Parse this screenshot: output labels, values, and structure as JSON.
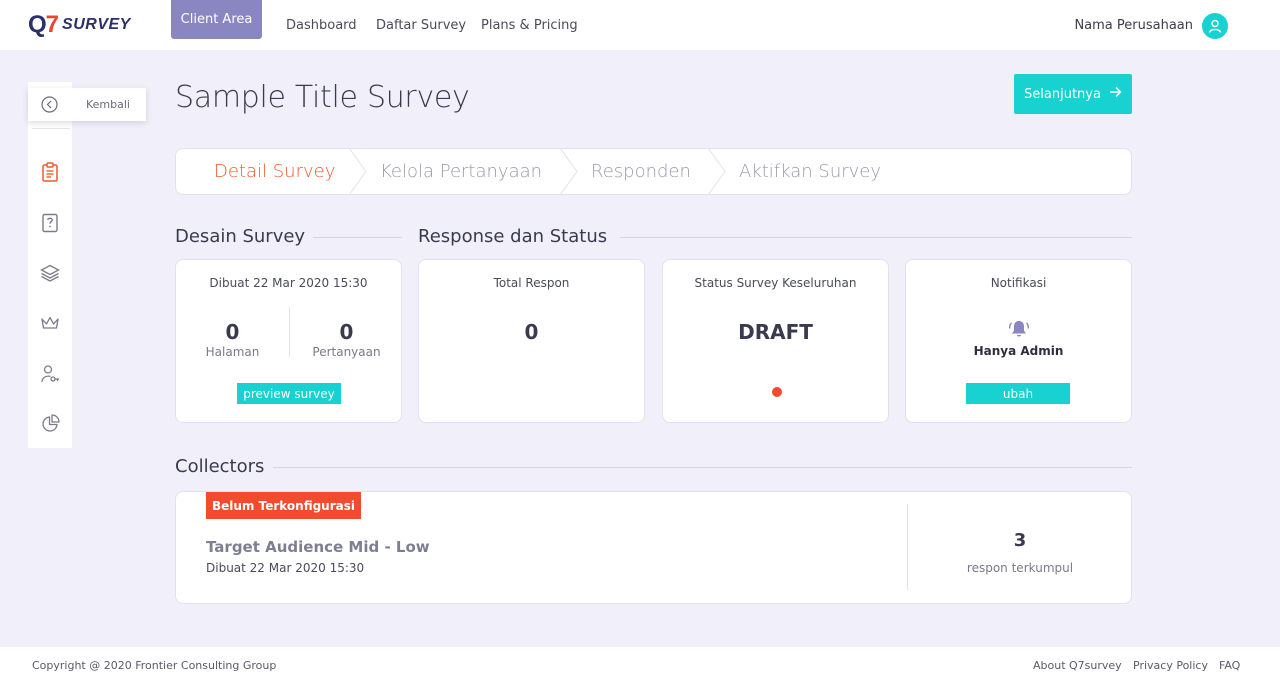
{
  "brand": {
    "logo_mark": "Q7",
    "logo_text": "SURVEY"
  },
  "nav": {
    "active": "Client Area",
    "links": [
      "Dashboard",
      "Daftar Survey",
      "Plans & Pricing"
    ],
    "company": "Nama Perusahaan"
  },
  "sidebar": {
    "back_label": "Kembali",
    "icons": [
      "clipboard-icon",
      "question-icon",
      "layers-icon",
      "crown-icon",
      "user-key-icon",
      "pie-chart-icon"
    ]
  },
  "page": {
    "title": "Sample Title Survey",
    "next_label": "Selanjutnya"
  },
  "steps": [
    "Detail Survey",
    "Kelola Pertanyaan",
    "Responden",
    "Aktifkan Survey"
  ],
  "desain": {
    "heading": "Desain Survey",
    "created": "Dibuat 22 Mar 2020  15:30",
    "pages_count": "0",
    "pages_label": "Halaman",
    "questions_count": "0",
    "questions_label": "Pertanyaan",
    "preview_label": "preview survey"
  },
  "response": {
    "heading": "Response dan Status",
    "total_label": "Total Respon",
    "total_value": "0",
    "status_label": "Status Survey Keseluruhan",
    "status_value": "DRAFT",
    "status_color": "#f24b2e",
    "notif_label": "Notifikasi",
    "notif_value": "Hanya Admin",
    "notif_button": "ubah"
  },
  "collectors": {
    "heading": "Collectors",
    "badge": "Belum Terkonfigurasi",
    "name": "Target Audience Mid - Low",
    "created": "Dibuat 22 Mar 2020  15:30",
    "count": "3",
    "count_label": "respon terkumpul"
  },
  "footer": {
    "copyright": "Copyright @ 2020 Frontier Consulting Group",
    "links": [
      "About Q7survey",
      "Privacy Policy",
      "FAQ"
    ]
  },
  "colors": {
    "accent": "#18d2d2",
    "active_step": "#ee5a2e",
    "nav_active": "#8a86c2",
    "brand_navy": "#2b2f6b"
  }
}
